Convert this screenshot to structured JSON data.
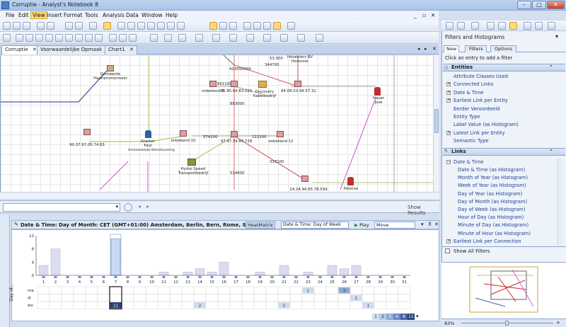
{
  "window": {
    "title": "Corruptie - Analyst's Notebook 8",
    "min_label": "–",
    "max_label": "□",
    "close_label": "✕"
  },
  "menu": [
    "File",
    "Edit",
    "View",
    "Insert",
    "Format",
    "Tools",
    "Analysis",
    "Data",
    "Window",
    "Help"
  ],
  "menu_controls": [
    "_",
    "▫",
    "✕"
  ],
  "tabs": [
    {
      "label": "Corruptie",
      "close": "✕"
    },
    {
      "label": "Voorwaardelijke Opmaak",
      "close": "✕"
    },
    {
      "label": "Chart1",
      "close": "✕"
    }
  ],
  "tab_controls": [
    "◂",
    "▸",
    "✕"
  ],
  "chart_nodes": {
    "gemeente": "Gemeente\nHaarlemmermeer",
    "ip_905": "90.37.97.05.74.83",
    "kramer": "Kramer\nPaul",
    "kramer_note": "Gemeentelijke Beleidsvoering",
    "onbekend10": "onbekend 10",
    "hydro": "Hydro Speed\nTransportbedrijf",
    "onbekend5": "onbekend 5",
    "ip_659": "65.95.94.83.020",
    "discovery": "Discovery\nKabelbedrijf",
    "hoveniers": "Hoveniers BV\nHovenier",
    "ip_840": "84.09.03.94.57.32",
    "ip_974": "97.47.39.43.728",
    "onbekend12": "onbekend 12",
    "hauer": "Hauer\nJose",
    "ip_241": "24.24.94.95.78.594",
    "bottom_person": "Peterse"
  },
  "chart_edges": [
    "423550000",
    "53.000",
    "344700",
    "661100",
    "883000",
    "574100",
    "122100",
    "333100",
    "514600"
  ],
  "search": {
    "placeholder": "",
    "show_results": "Show Results"
  },
  "heatmatrix": {
    "title": "Date & Time: Day of Month: CET (GMT+01:00) Amsterdam, Berlin, Bern, Rome, Stockh...",
    "label": "HeatMatrix",
    "dropdown": "Date & Time: Day of Week",
    "play": "Play",
    "mode": "Move"
  },
  "chart_data": {
    "type": "bar",
    "categories": [
      "1",
      "2",
      "3",
      "4",
      "5",
      "6",
      "7",
      "8",
      "9",
      "10",
      "11",
      "12",
      "13",
      "14",
      "15",
      "16",
      "17",
      "18",
      "19",
      "20",
      "21",
      "22",
      "23",
      "24",
      "25",
      "26",
      "27",
      "28",
      "29",
      "30",
      "31"
    ],
    "values": [
      3,
      8,
      0,
      0,
      0,
      0,
      11,
      0,
      0,
      0,
      1,
      0,
      1,
      2,
      1,
      4,
      0,
      0,
      1,
      0,
      3,
      0,
      1,
      0,
      3,
      2,
      3,
      0,
      0,
      0,
      0
    ],
    "ylim": [
      0,
      12
    ],
    "yticks": [
      "12",
      "8",
      "4",
      "0"
    ],
    "selected_category": "7",
    "heat_rows": [
      "ma",
      "di",
      "wo"
    ],
    "ylabel": "Day of...",
    "heat_values": [
      {
        "row": "ma",
        "day": "23",
        "value": "1"
      },
      {
        "row": "ma",
        "day": "26",
        "value": "3"
      },
      {
        "row": "di",
        "day": "27",
        "value": "1"
      },
      {
        "row": "wo",
        "day": "7",
        "value": "11"
      },
      {
        "row": "wo",
        "day": "14",
        "value": "2"
      },
      {
        "row": "wo",
        "day": "21",
        "value": "2"
      },
      {
        "row": "wo",
        "day": "28",
        "value": "1"
      }
    ],
    "legend": [
      "1",
      "2",
      "3",
      "4",
      "8",
      "11"
    ]
  },
  "right_panel": {
    "title": "Filters and Histograms",
    "hint": "Click an entry to add a filter",
    "tabs": [
      "New",
      "Filters",
      "Options"
    ],
    "entities_header": "Entities",
    "entity_items": [
      {
        "label": "Attribute Classes Used",
        "expandable": false
      },
      {
        "label": "Connected Links",
        "expandable": true
      },
      {
        "label": "Date & Time",
        "expandable": true
      },
      {
        "label": "Earliest Link per Entity",
        "expandable": true
      },
      {
        "label": "Eerder Veroordeeld",
        "expandable": false
      },
      {
        "label": "Entity Type",
        "expandable": false
      },
      {
        "label": "Label Value (as Histogram)",
        "expandable": false
      },
      {
        "label": "Latest Link per Entity",
        "expandable": true
      },
      {
        "label": "Semantic Type",
        "expandable": false
      }
    ],
    "links_header": "Links",
    "links_group": "Date & Time",
    "link_items": [
      "Date & Time (as Histogram)",
      "Month of Year (as Histogram)",
      "Week of Year (as Histogram)",
      "Day of Year (as Histogram)",
      "Day of Month (as Histogram)",
      "Day of Week (as Histogram)",
      "Hour of Day (as Histogram)",
      "Minute of Day (as Histogram)",
      "Minute of Hour (as Histogram)"
    ],
    "links_more": "Earliest Link per Connection",
    "show_all": "Show All Filters",
    "zoom": "83%"
  },
  "colors": {
    "accent": "#4a7fc4",
    "bar": "#dcdcf0",
    "bar_selected": "#c9daf5",
    "heat_low": "#cfdcf0",
    "heat_mid": "#8fa8d6",
    "heat_high": "#2c3f7a"
  }
}
